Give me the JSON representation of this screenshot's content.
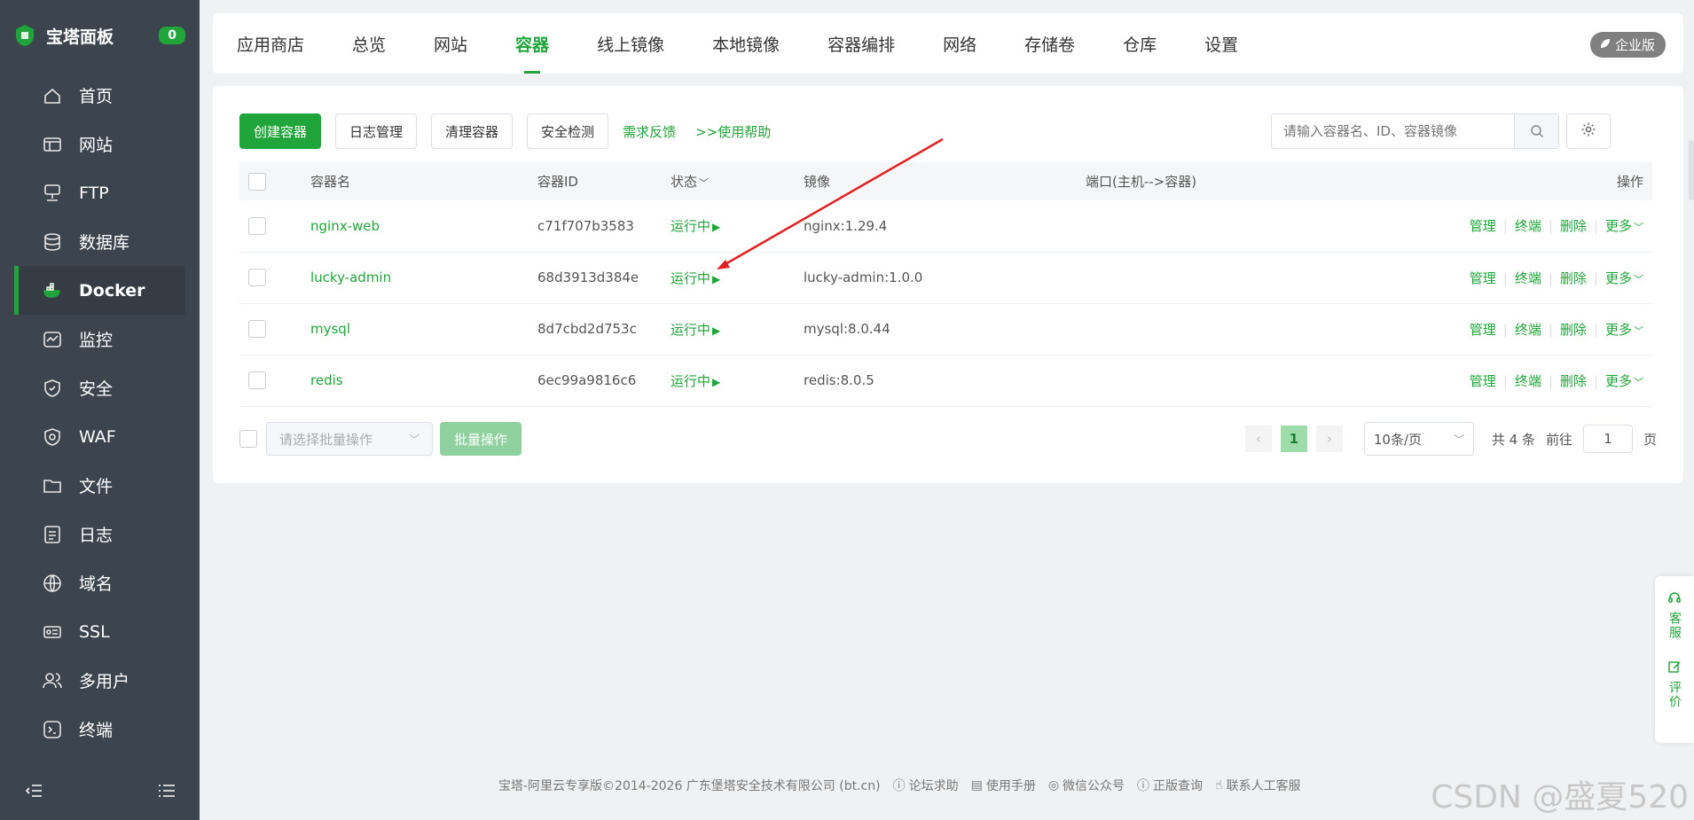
{
  "brand": {
    "title": "宝塔面板",
    "badge": "0"
  },
  "sidebar": {
    "items": [
      {
        "label": "首页",
        "icon": "home-icon"
      },
      {
        "label": "网站",
        "icon": "website-icon"
      },
      {
        "label": "FTP",
        "icon": "ftp-icon"
      },
      {
        "label": "数据库",
        "icon": "database-icon"
      },
      {
        "label": "Docker",
        "icon": "docker-icon",
        "active": true
      },
      {
        "label": "监控",
        "icon": "monitor-icon"
      },
      {
        "label": "安全",
        "icon": "shield-icon"
      },
      {
        "label": "WAF",
        "icon": "waf-icon"
      },
      {
        "label": "文件",
        "icon": "folder-icon"
      },
      {
        "label": "日志",
        "icon": "log-icon"
      },
      {
        "label": "域名",
        "icon": "globe-icon"
      },
      {
        "label": "SSL",
        "icon": "ssl-icon"
      },
      {
        "label": "多用户",
        "icon": "users-icon"
      },
      {
        "label": "终端",
        "icon": "terminal-icon"
      }
    ]
  },
  "tabs": [
    "应用商店",
    "总览",
    "网站",
    "容器",
    "线上镜像",
    "本地镜像",
    "容器编排",
    "网络",
    "存储卷",
    "仓库",
    "设置"
  ],
  "active_tab": "容器",
  "enterprise_label": "企业版",
  "toolbar": {
    "create": "创建容器",
    "log": "日志管理",
    "clean": "清理容器",
    "security": "安全检测",
    "feedback": "需求反馈",
    "help": ">>使用帮助"
  },
  "search": {
    "placeholder": "请输入容器名、ID、容器镜像"
  },
  "table": {
    "headers": {
      "name": "容器名",
      "id": "容器ID",
      "status": "状态",
      "image": "镜像",
      "port": "端口(主机-->容器)",
      "ops": "操作"
    },
    "rows": [
      {
        "name": "nginx-web",
        "id": "c71f707b3583",
        "status": "运行中",
        "image": "nginx:1.29.4"
      },
      {
        "name": "lucky-admin",
        "id": "68d3913d384e",
        "status": "运行中",
        "image": "lucky-admin:1.0.0"
      },
      {
        "name": "mysql",
        "id": "8d7cbd2d753c",
        "status": "运行中",
        "image": "mysql:8.0.44"
      },
      {
        "name": "redis",
        "id": "6ec99a9816c6",
        "status": "运行中",
        "image": "redis:8.0.5"
      }
    ],
    "ops": {
      "manage": "管理",
      "terminal": "终端",
      "delete": "删除",
      "more": "更多"
    }
  },
  "batch": {
    "placeholder": "请选择批量操作",
    "button": "批量操作"
  },
  "pager": {
    "current": "1",
    "size": "10条/页",
    "total": "共 4 条",
    "goto": "前往",
    "page_value": "1",
    "page_suffix": "页"
  },
  "float": {
    "service": "客服",
    "review": "评价"
  },
  "footer": {
    "copyright": "宝塔-阿里云专享版©2014-2026 广东堡塔安全技术有限公司 (bt.cn)",
    "links": [
      "论坛求助",
      "使用手册",
      "微信公众号",
      "正版查询",
      "联系人工客服"
    ]
  },
  "watermark": "CSDN @盛夏520",
  "colors": {
    "accent": "#20a53a",
    "sidebar": "#3c444d",
    "annotation": "#e02020"
  }
}
